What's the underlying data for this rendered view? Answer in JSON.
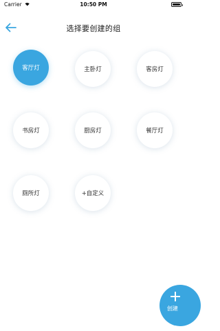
{
  "status_bar": {
    "carrier": "Carrier",
    "time": "10:50 PM",
    "wifi_icon": "wifi-icon",
    "battery_icon": "battery-icon"
  },
  "nav": {
    "back_icon": "arrow-left-icon",
    "title": "选择要创建的组"
  },
  "groups": [
    {
      "label": "客厅灯",
      "selected": true
    },
    {
      "label": "主卧灯",
      "selected": false
    },
    {
      "label": "客房灯",
      "selected": false
    },
    {
      "label": "书房灯",
      "selected": false
    },
    {
      "label": "厨房灯",
      "selected": false
    },
    {
      "label": "餐厅灯",
      "selected": false
    },
    {
      "label": "厕所灯",
      "selected": false
    },
    {
      "label": "+自定义",
      "selected": false
    }
  ],
  "create_button": {
    "icon": "plus-icon",
    "label": "创建"
  },
  "colors": {
    "accent": "#3aa6e0",
    "title_text": "#222222",
    "item_text": "#333333",
    "background": "#ffffff"
  }
}
